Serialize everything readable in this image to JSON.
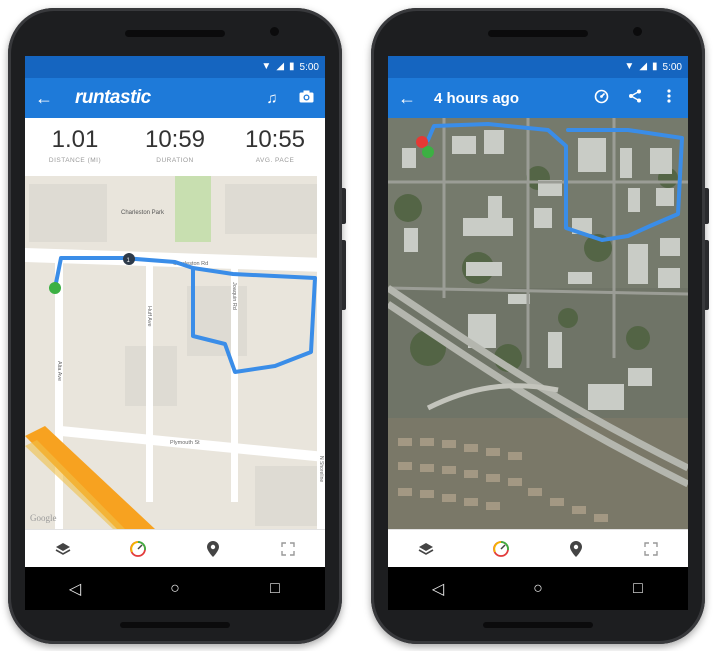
{
  "status_bar": {
    "time": "5:00"
  },
  "left_screen": {
    "brand": "runtastic",
    "stats": [
      {
        "value": "1.01",
        "label": "DISTANCE (MI)"
      },
      {
        "value": "10:59",
        "label": "DURATION"
      },
      {
        "value": "10:55",
        "label": "AVG. PACE"
      }
    ],
    "map": {
      "park_label": "Charleston Park",
      "road_charleston": "Charleston Rd",
      "road_huff": "Huff Ave",
      "road_joaquin": "Joaquin Rd",
      "road_alta": "Alta Ave",
      "road_plymouth": "Plymouth St",
      "road_shoreline": "N Shoreline",
      "watermark": "Google",
      "marker_km": "1"
    }
  },
  "right_screen": {
    "title": "4 hours ago"
  },
  "colors": {
    "status_bar": "#1565c0",
    "app_bar": "#1e7ad9",
    "route": "#3a8de8",
    "start_marker": "#3cb043",
    "end_marker": "#e53935"
  },
  "icons": {
    "back": "arrow-left-icon",
    "music": "music-note-icon",
    "camera": "camera-icon",
    "pace": "pace-icon",
    "share": "share-icon",
    "menu": "more-vert-icon",
    "layers": "layers-icon",
    "gauge": "speedometer-icon",
    "location": "location-pin-icon",
    "fullscreen": "fullscreen-icon"
  }
}
